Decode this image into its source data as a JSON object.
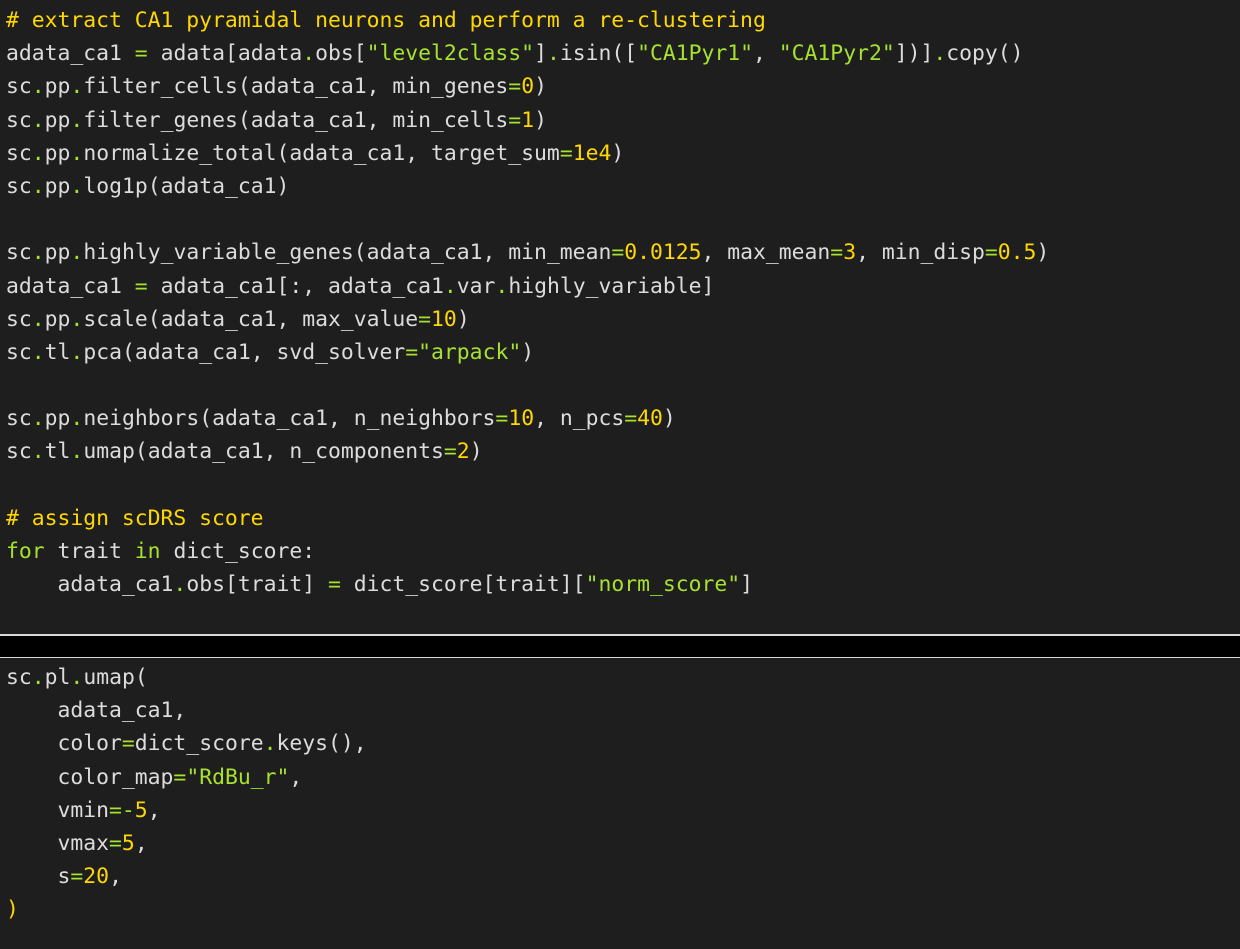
{
  "cells": [
    {
      "name": "code-cell-1",
      "lines": [
        [
          {
            "t": "# extract CA1 pyramidal neurons and perform a re-clustering",
            "c": "comment"
          }
        ],
        [
          {
            "t": "adata_ca1 ",
            "c": "id"
          },
          {
            "t": "=",
            "c": "op"
          },
          {
            "t": " adata[adata",
            "c": "id"
          },
          {
            "t": ".",
            "c": "op"
          },
          {
            "t": "obs[",
            "c": "id"
          },
          {
            "t": "\"level2class\"",
            "c": "str"
          },
          {
            "t": "]",
            "c": "id"
          },
          {
            "t": ".",
            "c": "op"
          },
          {
            "t": "isin([",
            "c": "id"
          },
          {
            "t": "\"CA1Pyr1\"",
            "c": "str"
          },
          {
            "t": ", ",
            "c": "id"
          },
          {
            "t": "\"CA1Pyr2\"",
            "c": "str"
          },
          {
            "t": "])]",
            "c": "id"
          },
          {
            "t": ".",
            "c": "op"
          },
          {
            "t": "copy()",
            "c": "id"
          }
        ],
        [
          {
            "t": "sc",
            "c": "id"
          },
          {
            "t": ".",
            "c": "op"
          },
          {
            "t": "pp",
            "c": "id"
          },
          {
            "t": ".",
            "c": "op"
          },
          {
            "t": "filter_cells(adata_ca1, min_genes",
            "c": "id"
          },
          {
            "t": "=",
            "c": "op"
          },
          {
            "t": "0",
            "c": "num"
          },
          {
            "t": ")",
            "c": "id"
          }
        ],
        [
          {
            "t": "sc",
            "c": "id"
          },
          {
            "t": ".",
            "c": "op"
          },
          {
            "t": "pp",
            "c": "id"
          },
          {
            "t": ".",
            "c": "op"
          },
          {
            "t": "filter_genes(adata_ca1, min_cells",
            "c": "id"
          },
          {
            "t": "=",
            "c": "op"
          },
          {
            "t": "1",
            "c": "num"
          },
          {
            "t": ")",
            "c": "id"
          }
        ],
        [
          {
            "t": "sc",
            "c": "id"
          },
          {
            "t": ".",
            "c": "op"
          },
          {
            "t": "pp",
            "c": "id"
          },
          {
            "t": ".",
            "c": "op"
          },
          {
            "t": "normalize_total(adata_ca1, target_sum",
            "c": "id"
          },
          {
            "t": "=",
            "c": "op"
          },
          {
            "t": "1e4",
            "c": "num"
          },
          {
            "t": ")",
            "c": "id"
          }
        ],
        [
          {
            "t": "sc",
            "c": "id"
          },
          {
            "t": ".",
            "c": "op"
          },
          {
            "t": "pp",
            "c": "id"
          },
          {
            "t": ".",
            "c": "op"
          },
          {
            "t": "log1p(adata_ca1)",
            "c": "id"
          }
        ],
        [],
        [
          {
            "t": "sc",
            "c": "id"
          },
          {
            "t": ".",
            "c": "op"
          },
          {
            "t": "pp",
            "c": "id"
          },
          {
            "t": ".",
            "c": "op"
          },
          {
            "t": "highly_variable_genes(adata_ca1, min_mean",
            "c": "id"
          },
          {
            "t": "=",
            "c": "op"
          },
          {
            "t": "0.0125",
            "c": "num"
          },
          {
            "t": ", max_mean",
            "c": "id"
          },
          {
            "t": "=",
            "c": "op"
          },
          {
            "t": "3",
            "c": "num"
          },
          {
            "t": ", min_disp",
            "c": "id"
          },
          {
            "t": "=",
            "c": "op"
          },
          {
            "t": "0.5",
            "c": "num"
          },
          {
            "t": ")",
            "c": "id"
          }
        ],
        [
          {
            "t": "adata_ca1 ",
            "c": "id"
          },
          {
            "t": "=",
            "c": "op"
          },
          {
            "t": " adata_ca1[:, adata_ca1",
            "c": "id"
          },
          {
            "t": ".",
            "c": "op"
          },
          {
            "t": "var",
            "c": "id"
          },
          {
            "t": ".",
            "c": "op"
          },
          {
            "t": "highly_variable]",
            "c": "id"
          }
        ],
        [
          {
            "t": "sc",
            "c": "id"
          },
          {
            "t": ".",
            "c": "op"
          },
          {
            "t": "pp",
            "c": "id"
          },
          {
            "t": ".",
            "c": "op"
          },
          {
            "t": "scale(adata_ca1, max_value",
            "c": "id"
          },
          {
            "t": "=",
            "c": "op"
          },
          {
            "t": "10",
            "c": "num"
          },
          {
            "t": ")",
            "c": "id"
          }
        ],
        [
          {
            "t": "sc",
            "c": "id"
          },
          {
            "t": ".",
            "c": "op"
          },
          {
            "t": "tl",
            "c": "id"
          },
          {
            "t": ".",
            "c": "op"
          },
          {
            "t": "pca(adata_ca1, svd_solver",
            "c": "id"
          },
          {
            "t": "=",
            "c": "op"
          },
          {
            "t": "\"arpack\"",
            "c": "str"
          },
          {
            "t": ")",
            "c": "id"
          }
        ],
        [],
        [
          {
            "t": "sc",
            "c": "id"
          },
          {
            "t": ".",
            "c": "op"
          },
          {
            "t": "pp",
            "c": "id"
          },
          {
            "t": ".",
            "c": "op"
          },
          {
            "t": "neighbors(adata_ca1, n_neighbors",
            "c": "id"
          },
          {
            "t": "=",
            "c": "op"
          },
          {
            "t": "10",
            "c": "num"
          },
          {
            "t": ", n_pcs",
            "c": "id"
          },
          {
            "t": "=",
            "c": "op"
          },
          {
            "t": "40",
            "c": "num"
          },
          {
            "t": ")",
            "c": "id"
          }
        ],
        [
          {
            "t": "sc",
            "c": "id"
          },
          {
            "t": ".",
            "c": "op"
          },
          {
            "t": "tl",
            "c": "id"
          },
          {
            "t": ".",
            "c": "op"
          },
          {
            "t": "umap(adata_ca1, n_components",
            "c": "id"
          },
          {
            "t": "=",
            "c": "op"
          },
          {
            "t": "2",
            "c": "num"
          },
          {
            "t": ")",
            "c": "id"
          }
        ],
        [],
        [
          {
            "t": "# assign scDRS score",
            "c": "comment"
          }
        ],
        [
          {
            "t": "for",
            "c": "kw"
          },
          {
            "t": " trait ",
            "c": "id"
          },
          {
            "t": "in",
            "c": "kw"
          },
          {
            "t": " dict_score:",
            "c": "id"
          }
        ],
        [
          {
            "t": "    adata_ca1",
            "c": "id"
          },
          {
            "t": ".",
            "c": "op"
          },
          {
            "t": "obs[trait] ",
            "c": "id"
          },
          {
            "t": "=",
            "c": "op"
          },
          {
            "t": " dict_score[trait][",
            "c": "id"
          },
          {
            "t": "\"norm_score\"",
            "c": "str"
          },
          {
            "t": "]",
            "c": "id"
          }
        ]
      ]
    },
    {
      "name": "code-cell-2",
      "lines": [
        [
          {
            "t": "sc",
            "c": "id"
          },
          {
            "t": ".",
            "c": "op"
          },
          {
            "t": "pl",
            "c": "id"
          },
          {
            "t": ".",
            "c": "op"
          },
          {
            "t": "umap(",
            "c": "id"
          }
        ],
        [
          {
            "t": "    adata_ca1,",
            "c": "id"
          }
        ],
        [
          {
            "t": "    color",
            "c": "id"
          },
          {
            "t": "=",
            "c": "op"
          },
          {
            "t": "dict_score",
            "c": "id"
          },
          {
            "t": ".",
            "c": "op"
          },
          {
            "t": "keys(),",
            "c": "id"
          }
        ],
        [
          {
            "t": "    color_map",
            "c": "id"
          },
          {
            "t": "=",
            "c": "op"
          },
          {
            "t": "\"RdBu_r\"",
            "c": "str"
          },
          {
            "t": ",",
            "c": "id"
          }
        ],
        [
          {
            "t": "    vmin",
            "c": "id"
          },
          {
            "t": "=-",
            "c": "op"
          },
          {
            "t": "5",
            "c": "num"
          },
          {
            "t": ",",
            "c": "id"
          }
        ],
        [
          {
            "t": "    vmax",
            "c": "id"
          },
          {
            "t": "=",
            "c": "op"
          },
          {
            "t": "5",
            "c": "num"
          },
          {
            "t": ",",
            "c": "id"
          }
        ],
        [
          {
            "t": "    s",
            "c": "id"
          },
          {
            "t": "=",
            "c": "op"
          },
          {
            "t": "20",
            "c": "num"
          },
          {
            "t": ",",
            "c": "id"
          }
        ],
        [
          {
            "t": ")",
            "c": "paren"
          }
        ]
      ]
    }
  ],
  "colors": {
    "background": "#1e1e1e",
    "separator": "#000000",
    "text": "#dcdcdc",
    "comment": "#ffd700",
    "string": "#a6e22e",
    "number": "#ffd700",
    "operator": "#a6e22e"
  }
}
